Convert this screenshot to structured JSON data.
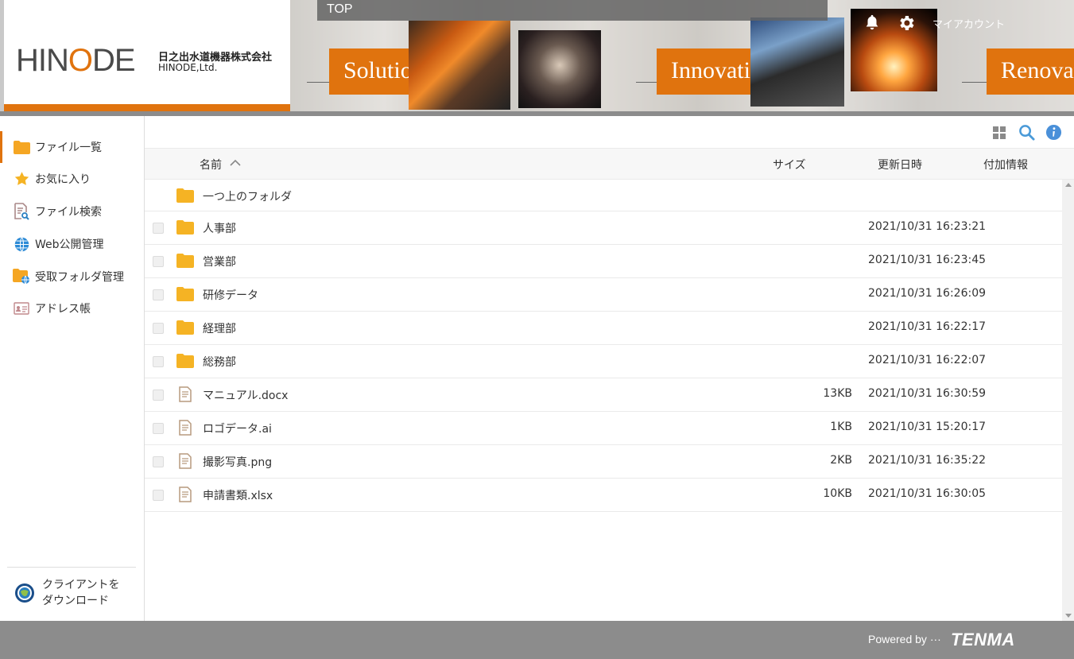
{
  "header": {
    "brand": "HINODE",
    "company_jp": "日之出水道機器株式会社",
    "company_en": "HINODE,Ltd.",
    "top_label": "TOP",
    "banner_tags": [
      "Solution",
      "Innovation",
      "Renovat"
    ],
    "my_account": "マイアカウント",
    "accent_color": "#e0730e"
  },
  "sidebar": {
    "items": [
      {
        "label": "ファイル一覧",
        "icon": "folder-icon",
        "active": true
      },
      {
        "label": "お気に入り",
        "icon": "star-icon"
      },
      {
        "label": "ファイル検索",
        "icon": "file-search-icon"
      },
      {
        "label": "Web公開管理",
        "icon": "globe-icon"
      },
      {
        "label": "受取フォルダ管理",
        "icon": "folder-globe-icon"
      },
      {
        "label": "アドレス帳",
        "icon": "address-card-icon"
      }
    ],
    "client_download": "クライアントを\nダウンロード"
  },
  "table": {
    "columns": {
      "name": "名前",
      "size": "サイズ",
      "modified": "更新日時",
      "extra": "付加情報"
    },
    "parent_folder": "一つ上のフォルダ",
    "rows": [
      {
        "name": "人事部",
        "type": "folder",
        "size": "",
        "date": "2021/10/31 16:23:21"
      },
      {
        "name": "営業部",
        "type": "folder",
        "size": "",
        "date": "2021/10/31 16:23:45"
      },
      {
        "name": "研修データ",
        "type": "folder",
        "size": "",
        "date": "2021/10/31 16:26:09"
      },
      {
        "name": "経理部",
        "type": "folder",
        "size": "",
        "date": "2021/10/31 16:22:17"
      },
      {
        "name": "総務部",
        "type": "folder",
        "size": "",
        "date": "2021/10/31 16:22:07"
      },
      {
        "name": "マニュアル.docx",
        "type": "file",
        "size": "13KB",
        "date": "2021/10/31 16:30:59"
      },
      {
        "name": "ロゴデータ.ai",
        "type": "file",
        "size": "1KB",
        "date": "2021/10/31 15:20:17"
      },
      {
        "name": "撮影写真.png",
        "type": "file",
        "size": "2KB",
        "date": "2021/10/31 16:35:22"
      },
      {
        "name": "申請書類.xlsx",
        "type": "file",
        "size": "10KB",
        "date": "2021/10/31 16:30:05"
      }
    ]
  },
  "footer": {
    "powered_by": "Powered by ···",
    "brand": "TENMA"
  }
}
